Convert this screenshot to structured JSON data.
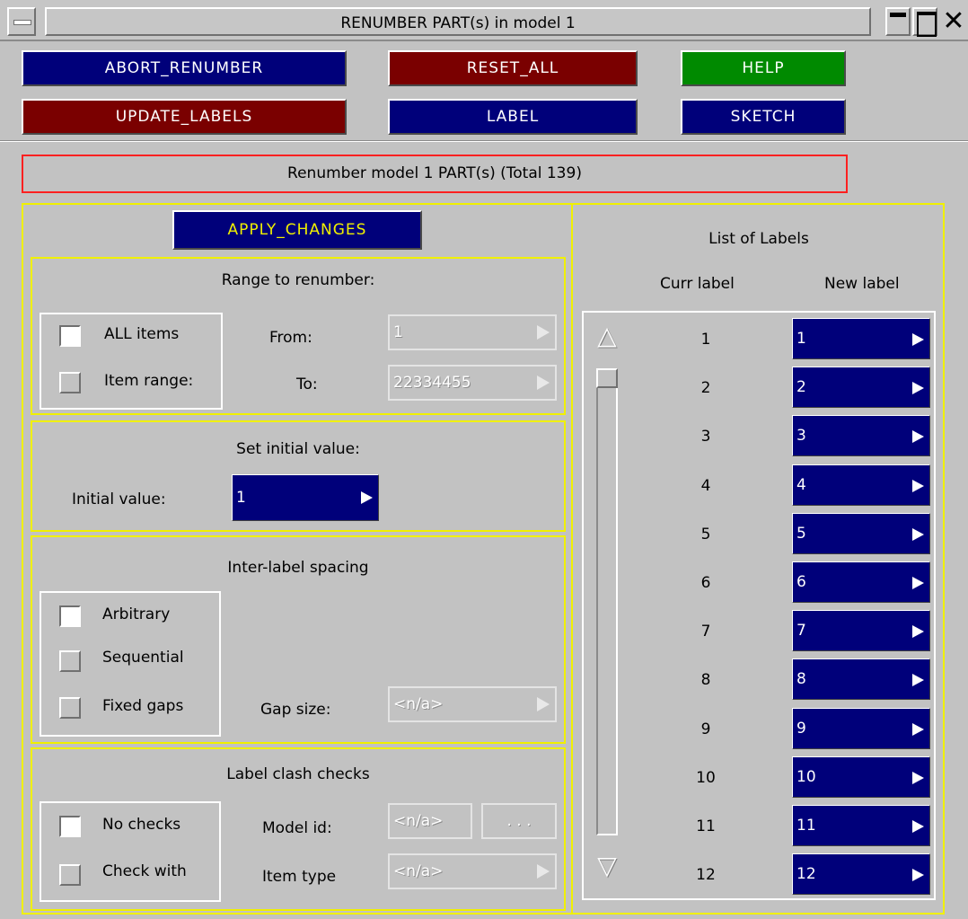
{
  "window": {
    "title": "RENUMBER PART(s) in model 1"
  },
  "toolbar": {
    "abort": "ABORT_RENUMBER",
    "reset_all": "RESET_ALL",
    "help": "HELP",
    "update_labels": "UPDATE_LABELS",
    "label": "LABEL",
    "sketch": "SKETCH"
  },
  "status": "Renumber model 1 PART(s) (Total 139)",
  "apply_changes": "APPLY_CHANGES",
  "range": {
    "title": "Range to renumber:",
    "all_items": "ALL items",
    "item_range": "Item range:",
    "from_label": "From:",
    "from_value": "1",
    "to_label": "To:",
    "to_value": "22334455"
  },
  "initial": {
    "title": "Set initial value:",
    "label": "Initial value:",
    "value": "1"
  },
  "spacing": {
    "title": "Inter-label spacing",
    "arbitrary": "Arbitrary",
    "sequential": "Sequential",
    "fixed_gaps": "Fixed gaps",
    "gap_label": "Gap size:",
    "gap_value": "<n/a>"
  },
  "clash": {
    "title": "Label clash checks",
    "no_checks": "No checks",
    "check_with": "Check with",
    "model_id_label": "Model id:",
    "model_id_value": "<n/a>",
    "browse": ". . .",
    "item_type_label": "Item type",
    "item_type_value": "<n/a>"
  },
  "labels": {
    "title": "List of Labels",
    "curr_header": "Curr label",
    "new_header": "New label",
    "rows": [
      {
        "curr": "1",
        "new": "1"
      },
      {
        "curr": "2",
        "new": "2"
      },
      {
        "curr": "3",
        "new": "3"
      },
      {
        "curr": "4",
        "new": "4"
      },
      {
        "curr": "5",
        "new": "5"
      },
      {
        "curr": "6",
        "new": "6"
      },
      {
        "curr": "7",
        "new": "7"
      },
      {
        "curr": "8",
        "new": "8"
      },
      {
        "curr": "9",
        "new": "9"
      },
      {
        "curr": "10",
        "new": "10"
      },
      {
        "curr": "11",
        "new": "11"
      },
      {
        "curr": "12",
        "new": "12"
      }
    ]
  }
}
